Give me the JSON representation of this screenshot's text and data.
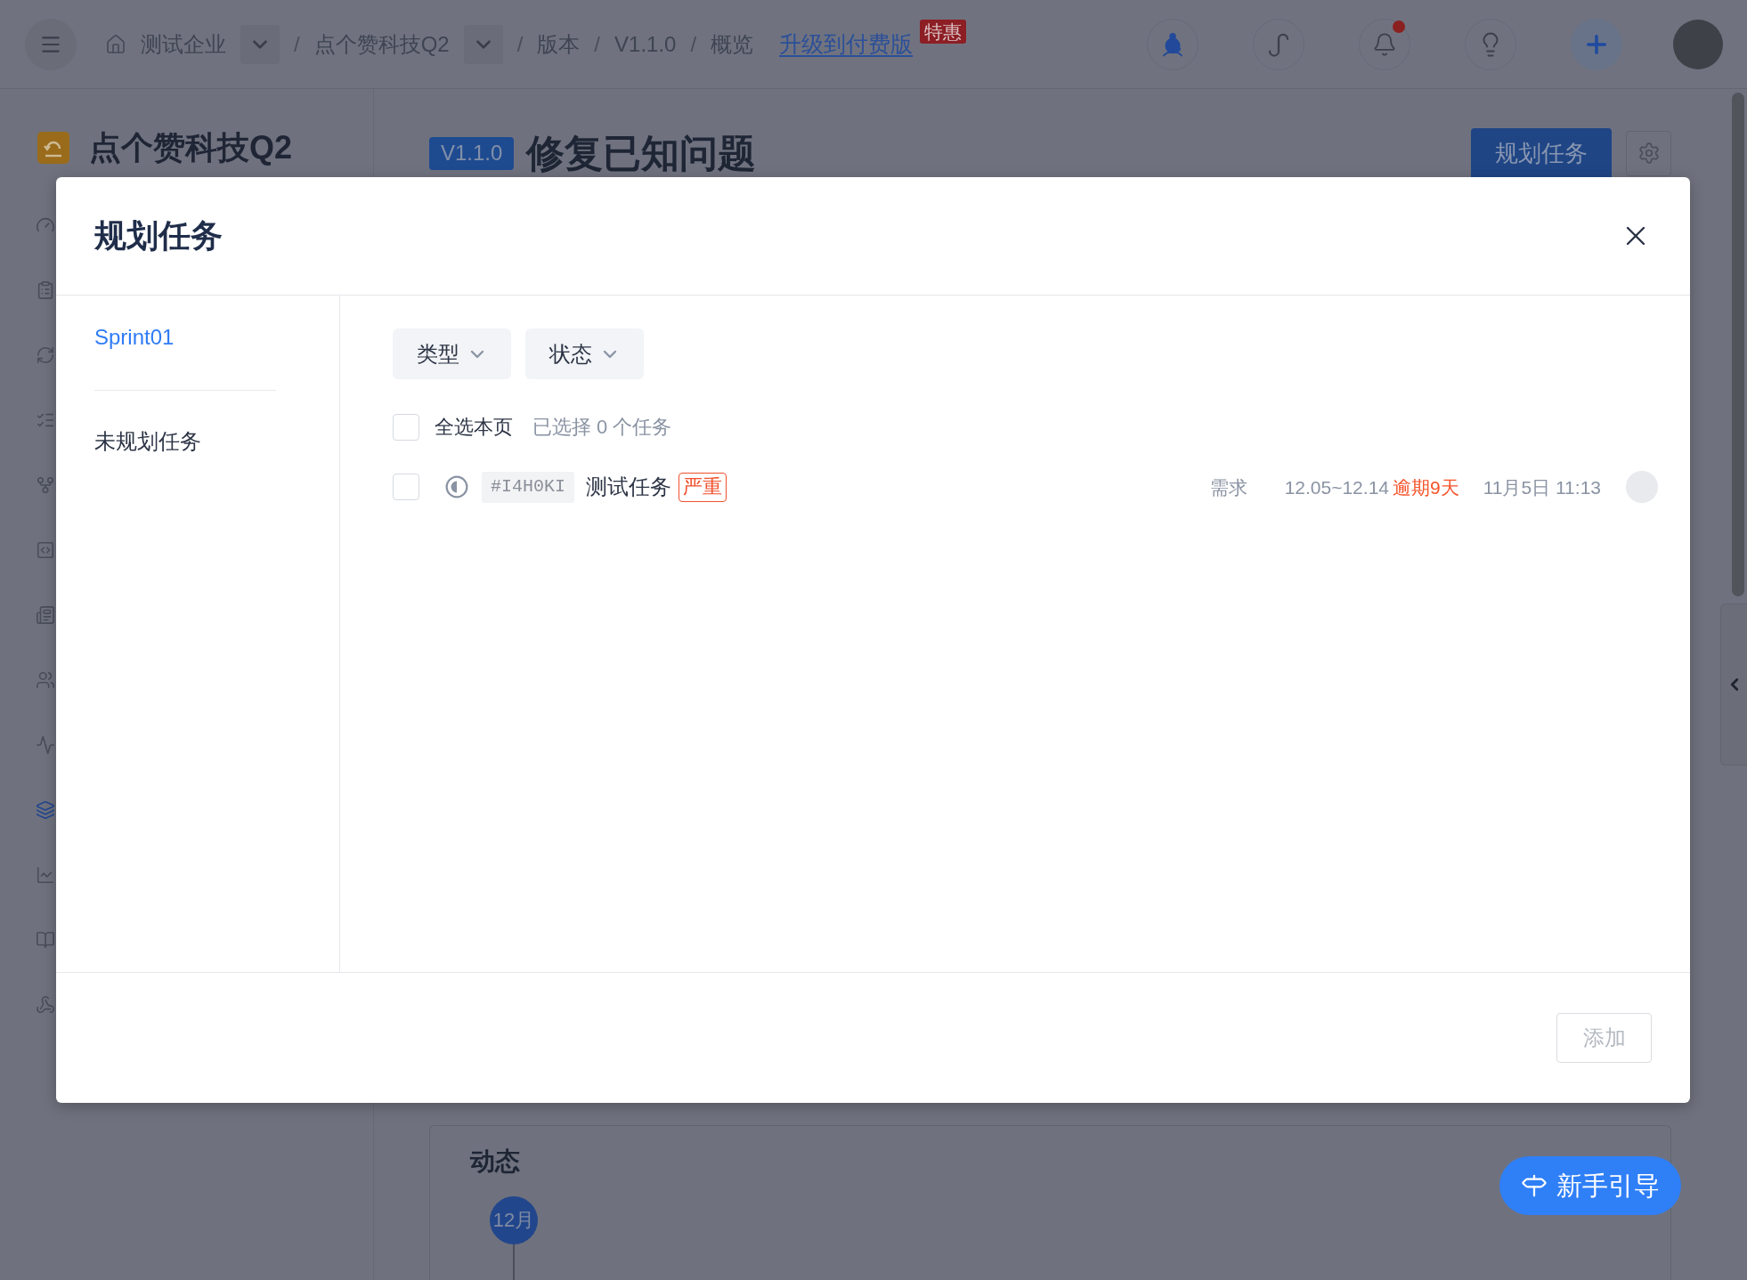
{
  "top_bar": {
    "breadcrumbs": [
      {
        "label": "测试企业",
        "has_menu": true
      },
      {
        "label": "点个赞科技Q2",
        "has_menu": true
      },
      {
        "label": "版本",
        "has_menu": false
      },
      {
        "label": "V1.1.0",
        "has_menu": false
      },
      {
        "label": "概览",
        "has_menu": false
      }
    ],
    "separators": [
      "/",
      "/",
      "/",
      "/"
    ],
    "upgrade_link": {
      "label": "升级到付费版",
      "badge": "特惠"
    },
    "notifications": {
      "unread": true
    }
  },
  "sidebar": {
    "project_name": "点个赞科技Q2",
    "nav": [
      {
        "selected": false
      },
      {
        "selected": false
      },
      {
        "selected": false
      },
      {
        "selected": false
      },
      {
        "selected": false
      },
      {
        "selected": false
      },
      {
        "selected": false
      },
      {
        "selected": false
      },
      {
        "selected": false
      },
      {
        "selected": true
      },
      {
        "selected": false
      },
      {
        "selected": false
      },
      {
        "selected": false
      }
    ]
  },
  "page_header": {
    "version_badge": "V1.1.0",
    "title": "修复已知问题",
    "plan_button": "规划任务"
  },
  "activity": {
    "title": "动态",
    "month": "12月"
  },
  "guide_button": "新手引导",
  "modal": {
    "title": "规划任务",
    "groups": [
      {
        "label": "Sprint01",
        "selected": true
      },
      {
        "label": "未规划任务",
        "selected": false
      }
    ],
    "filters": [
      {
        "label": "类型"
      },
      {
        "label": "状态"
      }
    ],
    "select_all": {
      "label": "全选本页",
      "checked": false
    },
    "selection_count": "已选择 0 个任务",
    "tasks": [
      {
        "checked": false,
        "id": "#I4H0KI",
        "title": "测试任务",
        "priority": "严重",
        "type": "需求",
        "dates": "12.05~12.14",
        "overdue": "逾期9天",
        "updated": "11月5日 11:13"
      }
    ],
    "add_button": {
      "label": "添加",
      "disabled": true
    }
  }
}
